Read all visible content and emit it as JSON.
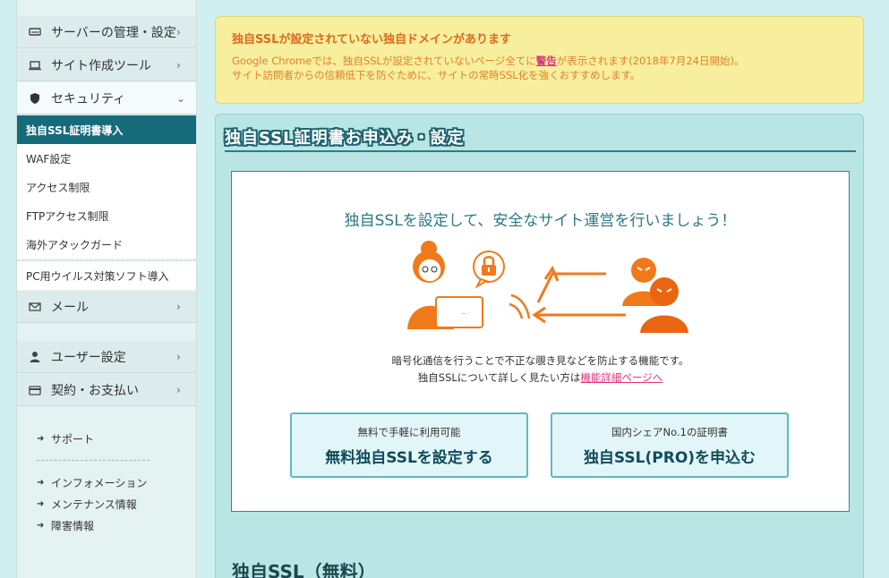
{
  "sidebar": {
    "items": [
      {
        "label": "サーバーの管理・設定",
        "icon": "server-icon",
        "chevron": "›"
      },
      {
        "label": "サイト作成ツール",
        "icon": "laptop-icon",
        "chevron": "›"
      },
      {
        "label": "セキュリティ",
        "icon": "shield-icon",
        "chevron": "⌄"
      },
      {
        "label": "メール",
        "icon": "mail-icon",
        "chevron": "›"
      },
      {
        "label": "ユーザー設定",
        "icon": "user-icon",
        "chevron": "›"
      },
      {
        "label": "契約・お支払い",
        "icon": "card-icon",
        "chevron": "›"
      }
    ],
    "security_sub": [
      {
        "label": "独自SSL証明書導入",
        "active": true
      },
      {
        "label": "WAF設定"
      },
      {
        "label": "アクセス制限"
      },
      {
        "label": "FTPアクセス制限"
      },
      {
        "label": "海外アタックガード"
      },
      {
        "label": "PC用ウイルス対策ソフト導入"
      }
    ],
    "support": {
      "support_label": "サポート",
      "links": [
        "インフォメーション",
        "メンテナンス情報",
        "障害情報"
      ]
    }
  },
  "alert": {
    "title": "独自SSLが設定されていない独自ドメインがあります",
    "line1_pre": "Google Chromeでは、独自SSLが設定されていないページ全てに",
    "line1_link": "警告",
    "line1_post": "が表示されます(2018年7月24日開始)。",
    "line2": "サイト訪問者からの信頼低下を防ぐために、サイトの常時SSL化を強くおすすめします。"
  },
  "panel": {
    "title": "独自SSL証明書お申込み・設定",
    "heading": "独自SSLを設定して、安全なサイト運営を行いましょう！",
    "desc1": "暗号化通信を行うことで不正な覗き見などを防止する機能です。",
    "desc2_pre": "独自SSLについて詳しく見たい方は",
    "desc2_link": "機能詳細ページへ",
    "cta_free": {
      "sub": "無料で手軽に利用可能",
      "main": "無料独自SSLを設定する"
    },
    "cta_pro": {
      "sub": "国内シェアNo.1の証明書",
      "main": "独自SSL(PRO)を申込む"
    }
  },
  "section": {
    "title": "独自SSL（無料）"
  },
  "colors": {
    "accent": "#156b7a",
    "illustration": "#f07a1a",
    "alert_bg": "#f7ee9e",
    "link": "#e0357a"
  }
}
